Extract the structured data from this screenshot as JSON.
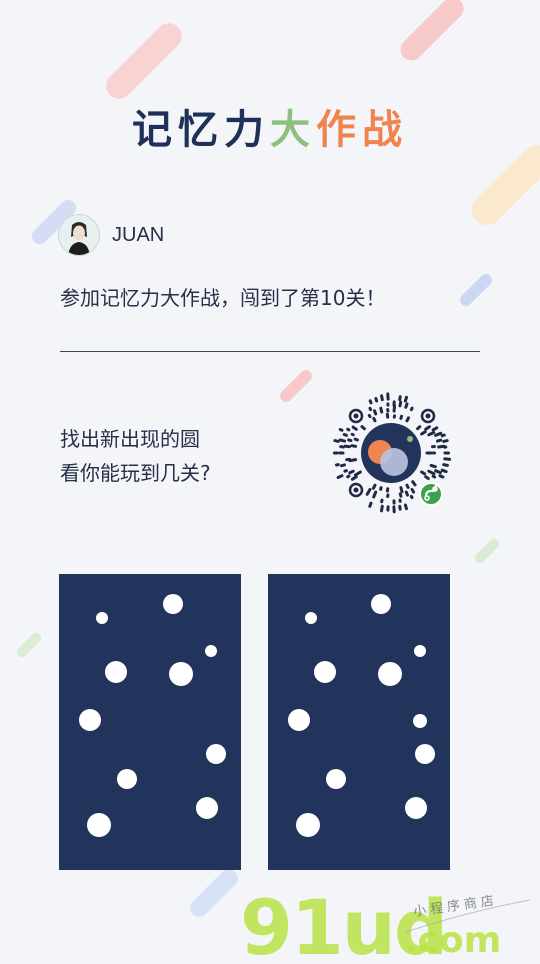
{
  "title": {
    "part1": "记忆力",
    "part2": "大",
    "part3": "作战"
  },
  "colors": {
    "navy": "#22345c",
    "green": "#8dc07e",
    "orange": "#f0844f",
    "background": "#f4f5f8"
  },
  "user": {
    "name": "JUAN"
  },
  "message": "参加记忆力大作战，闯到了第10关！",
  "prompt": {
    "line1": "找出新出现的圆",
    "line2": "看你能玩到几关?"
  },
  "icons": [
    "avatar",
    "mini-program-qr-code",
    "mini-program-logo-icon"
  ],
  "watermark": {
    "brand": "91ud",
    "domain": ".com",
    "tagline": "小程序商店"
  }
}
